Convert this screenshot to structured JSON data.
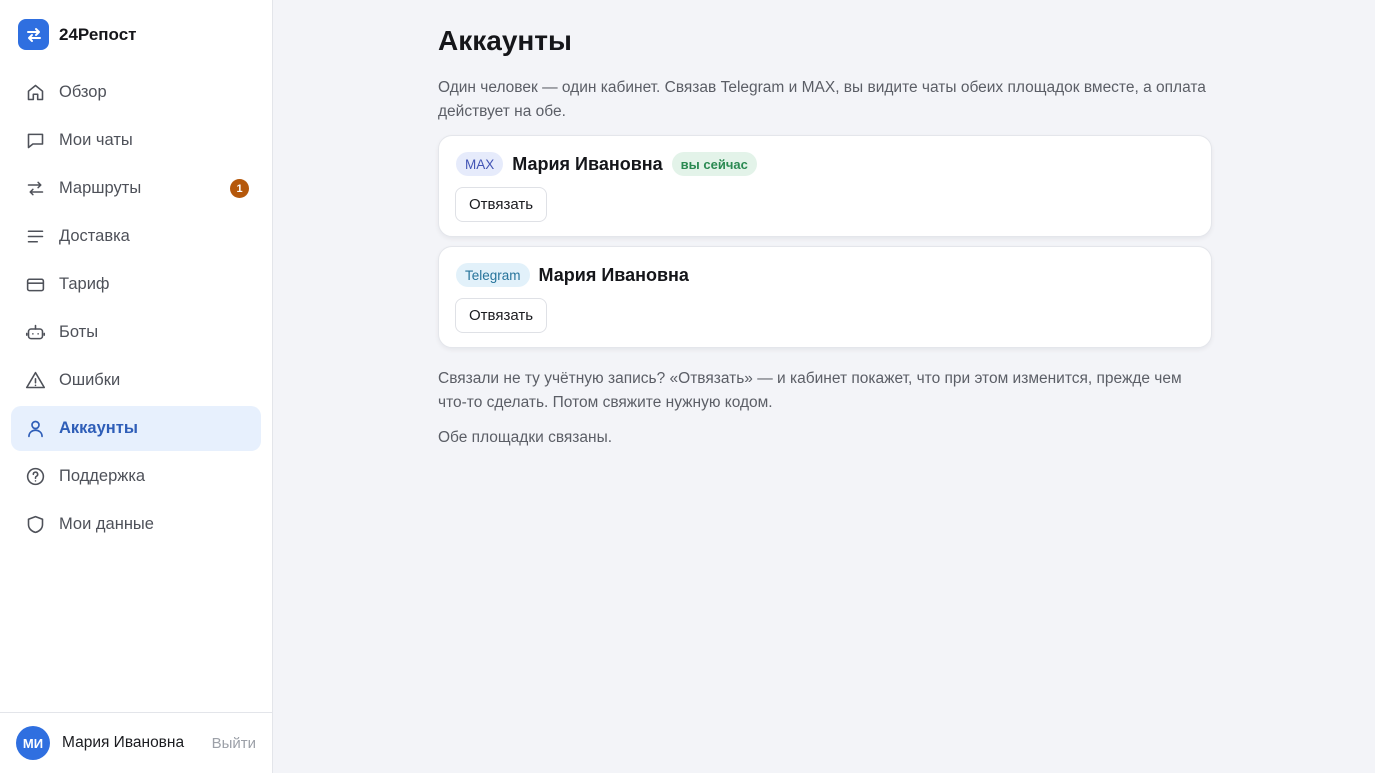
{
  "brand": {
    "name": "24Репост"
  },
  "sidebar": {
    "items": [
      {
        "label": "Обзор",
        "icon": "home-icon"
      },
      {
        "label": "Мои чаты",
        "icon": "chat-icon"
      },
      {
        "label": "Маршруты",
        "icon": "routes-icon",
        "badge": "1"
      },
      {
        "label": "Доставка",
        "icon": "list-icon"
      },
      {
        "label": "Тариф",
        "icon": "card-icon"
      },
      {
        "label": "Боты",
        "icon": "bot-icon"
      },
      {
        "label": "Ошибки",
        "icon": "warning-icon"
      },
      {
        "label": "Аккаунты",
        "icon": "user-icon",
        "active": true
      },
      {
        "label": "Поддержка",
        "icon": "help-icon"
      },
      {
        "label": "Мои данные",
        "icon": "shield-icon"
      }
    ]
  },
  "user": {
    "initials": "МИ",
    "name": "Мария Ивановна",
    "logout": "Выйти"
  },
  "page": {
    "title": "Аккаунты",
    "intro": "Один человек — один кабинет. Связав Telegram и MAX, вы видите чаты обеих площадок вместе, а оплата действует на обе."
  },
  "accounts": [
    {
      "platform": "MAX",
      "name": "Мария Ивановна",
      "current_badge": "вы сейчас",
      "unlink_label": "Отвязать"
    },
    {
      "platform": "Telegram",
      "name": "Мария Ивановна",
      "unlink_label": "Отвязать"
    }
  ],
  "notes": {
    "wrong_account": "Связали не ту учётную запись? «Отвязать» — и кабинет покажет, что при этом изменится, прежде чем что-то сделать. Потом свяжите нужную кодом.",
    "status": "Обе площадки связаны."
  },
  "colors": {
    "accent": "#2f6fe0",
    "badge": "#b5580b",
    "active_bg": "#e7f0fd",
    "success": "#2b8a52"
  }
}
